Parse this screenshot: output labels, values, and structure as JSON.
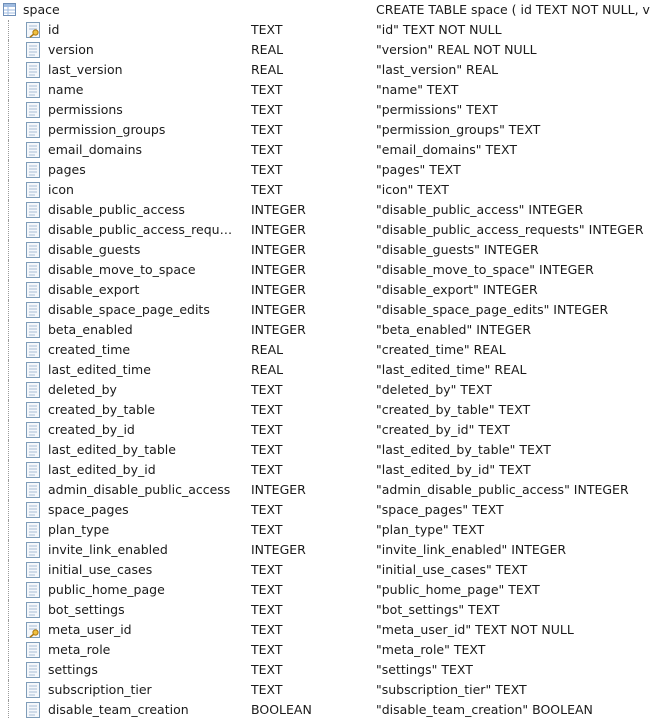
{
  "table": {
    "name": "space",
    "sql": "CREATE TABLE space ( id TEXT NOT NULL, v",
    "icon": "table-icon"
  },
  "columns": [
    {
      "name": "id",
      "type": "TEXT",
      "sql": "\"id\" TEXT NOT NULL",
      "icon": "key-column-icon"
    },
    {
      "name": "version",
      "type": "REAL",
      "sql": "\"version\" REAL NOT NULL",
      "icon": "column-icon"
    },
    {
      "name": "last_version",
      "type": "REAL",
      "sql": "\"last_version\" REAL",
      "icon": "column-icon"
    },
    {
      "name": "name",
      "type": "TEXT",
      "sql": "\"name\" TEXT",
      "icon": "column-icon"
    },
    {
      "name": "permissions",
      "type": "TEXT",
      "sql": "\"permissions\" TEXT",
      "icon": "column-icon"
    },
    {
      "name": "permission_groups",
      "type": "TEXT",
      "sql": "\"permission_groups\" TEXT",
      "icon": "column-icon"
    },
    {
      "name": "email_domains",
      "type": "TEXT",
      "sql": "\"email_domains\" TEXT",
      "icon": "column-icon"
    },
    {
      "name": "pages",
      "type": "TEXT",
      "sql": "\"pages\" TEXT",
      "icon": "column-icon"
    },
    {
      "name": "icon",
      "type": "TEXT",
      "sql": "\"icon\" TEXT",
      "icon": "column-icon"
    },
    {
      "name": "disable_public_access",
      "type": "INTEGER",
      "sql": "\"disable_public_access\" INTEGER",
      "icon": "column-icon"
    },
    {
      "name": "disable_public_access_requ…",
      "type": "INTEGER",
      "sql": "\"disable_public_access_requests\" INTEGER",
      "icon": "column-icon"
    },
    {
      "name": "disable_guests",
      "type": "INTEGER",
      "sql": "\"disable_guests\" INTEGER",
      "icon": "column-icon"
    },
    {
      "name": "disable_move_to_space",
      "type": "INTEGER",
      "sql": "\"disable_move_to_space\" INTEGER",
      "icon": "column-icon"
    },
    {
      "name": "disable_export",
      "type": "INTEGER",
      "sql": "\"disable_export\" INTEGER",
      "icon": "column-icon"
    },
    {
      "name": "disable_space_page_edits",
      "type": "INTEGER",
      "sql": "\"disable_space_page_edits\" INTEGER",
      "icon": "column-icon"
    },
    {
      "name": "beta_enabled",
      "type": "INTEGER",
      "sql": "\"beta_enabled\" INTEGER",
      "icon": "column-icon"
    },
    {
      "name": "created_time",
      "type": "REAL",
      "sql": "\"created_time\" REAL",
      "icon": "column-icon"
    },
    {
      "name": "last_edited_time",
      "type": "REAL",
      "sql": "\"last_edited_time\" REAL",
      "icon": "column-icon"
    },
    {
      "name": "deleted_by",
      "type": "TEXT",
      "sql": "\"deleted_by\" TEXT",
      "icon": "column-icon"
    },
    {
      "name": "created_by_table",
      "type": "TEXT",
      "sql": "\"created_by_table\" TEXT",
      "icon": "column-icon"
    },
    {
      "name": "created_by_id",
      "type": "TEXT",
      "sql": "\"created_by_id\" TEXT",
      "icon": "column-icon"
    },
    {
      "name": "last_edited_by_table",
      "type": "TEXT",
      "sql": "\"last_edited_by_table\" TEXT",
      "icon": "column-icon"
    },
    {
      "name": "last_edited_by_id",
      "type": "TEXT",
      "sql": "\"last_edited_by_id\" TEXT",
      "icon": "column-icon"
    },
    {
      "name": "admin_disable_public_access",
      "type": "INTEGER",
      "sql": "\"admin_disable_public_access\" INTEGER",
      "icon": "column-icon"
    },
    {
      "name": "space_pages",
      "type": "TEXT",
      "sql": "\"space_pages\" TEXT",
      "icon": "column-icon"
    },
    {
      "name": "plan_type",
      "type": "TEXT",
      "sql": "\"plan_type\" TEXT",
      "icon": "column-icon"
    },
    {
      "name": "invite_link_enabled",
      "type": "INTEGER",
      "sql": "\"invite_link_enabled\" INTEGER",
      "icon": "column-icon"
    },
    {
      "name": "initial_use_cases",
      "type": "TEXT",
      "sql": "\"initial_use_cases\" TEXT",
      "icon": "column-icon"
    },
    {
      "name": "public_home_page",
      "type": "TEXT",
      "sql": "\"public_home_page\" TEXT",
      "icon": "column-icon"
    },
    {
      "name": "bot_settings",
      "type": "TEXT",
      "sql": "\"bot_settings\" TEXT",
      "icon": "column-icon"
    },
    {
      "name": "meta_user_id",
      "type": "TEXT",
      "sql": "\"meta_user_id\" TEXT NOT NULL",
      "icon": "key-column-icon"
    },
    {
      "name": "meta_role",
      "type": "TEXT",
      "sql": "\"meta_role\" TEXT",
      "icon": "column-icon"
    },
    {
      "name": "settings",
      "type": "TEXT",
      "sql": "\"settings\" TEXT",
      "icon": "column-icon"
    },
    {
      "name": "subscription_tier",
      "type": "TEXT",
      "sql": "\"subscription_tier\" TEXT",
      "icon": "column-icon"
    },
    {
      "name": "disable_team_creation",
      "type": "BOOLEAN",
      "sql": "\"disable_team_creation\" BOOLEAN",
      "icon": "column-icon"
    }
  ],
  "colors": {
    "text": "#1a1a1a",
    "icon_border": "#7f9db9",
    "key_gold": "#d9a21b"
  }
}
